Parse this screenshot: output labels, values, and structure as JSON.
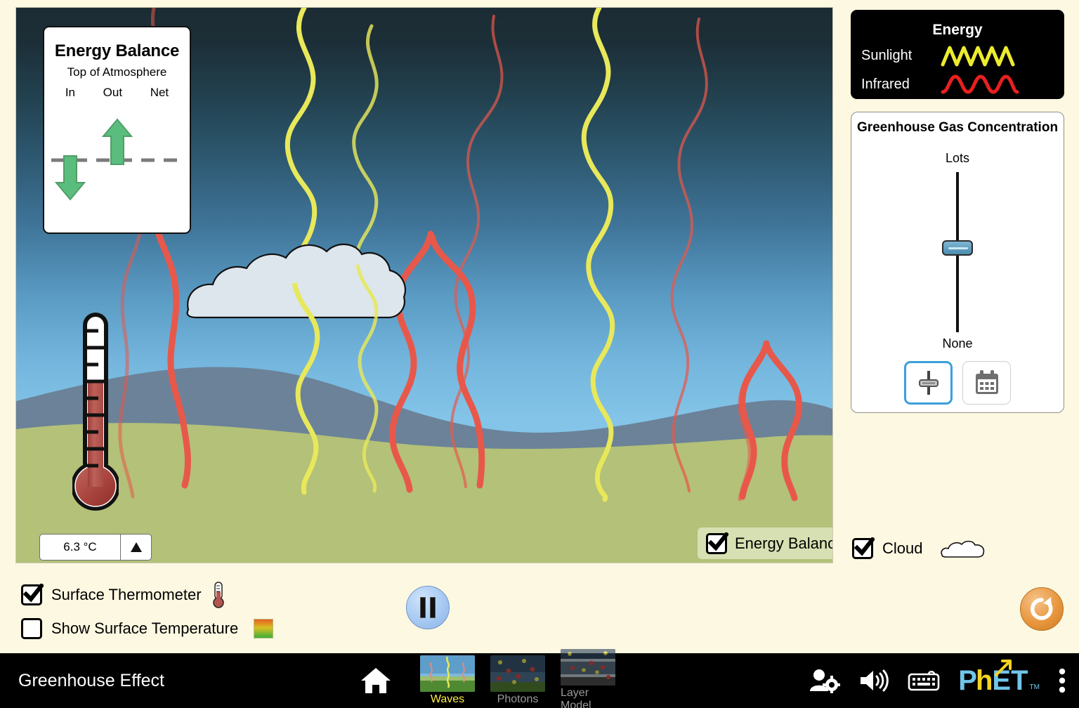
{
  "app": {
    "title": "Greenhouse Effect"
  },
  "energy_balance_panel": {
    "title": "Energy Balance",
    "subtitle": "Top of Atmosphere",
    "columns": [
      "In",
      "Out",
      "Net"
    ],
    "arrow_color": "#5bbd7d",
    "in_direction": "down",
    "out_direction": "up",
    "net_value": "zero"
  },
  "thermometer": {
    "value_label": "6.3 °C",
    "expand_icon": "triangle-up-icon",
    "fill_color": "#b4564f"
  },
  "scene": {
    "energy_balance_checkbox": {
      "label": "Energy Balance",
      "checked": true
    },
    "sky_top_color": "#1b2c34",
    "sky_bottom_color": "#85c5e9",
    "mountain_color": "#6b8299",
    "grass_color": "#b3c179",
    "cloud_fill": "#dce6ec",
    "sunlight_color": "#e8e85a",
    "infrared_color": "#e8584a",
    "waves": {
      "sunlight_x": [
        430,
        520,
        845
      ],
      "infrared_x": [
        190,
        600,
        690,
        980,
        1090
      ]
    }
  },
  "energy_legend": {
    "title": "Energy",
    "rows": [
      {
        "label": "Sunlight",
        "color": "#ecec2f",
        "wave": "high-frequency"
      },
      {
        "label": "Infrared",
        "color": "#e82020",
        "wave": "low-frequency"
      }
    ]
  },
  "ghg_panel": {
    "title": "Greenhouse Gas Concentration",
    "max_label": "Lots",
    "min_label": "None",
    "slider_value_fraction": 0.575,
    "thumb_color": "#5a9ec2",
    "mode_buttons": [
      {
        "name": "slider-mode",
        "icon": "slider-icon",
        "selected": true
      },
      {
        "name": "date-mode",
        "icon": "calendar-icon",
        "selected": false
      }
    ],
    "selected_outline_color": "#3aa0db"
  },
  "cloud_checkbox": {
    "label": "Cloud",
    "checked": true,
    "icon": "cloud-icon"
  },
  "bottom_controls": {
    "checkboxes": [
      {
        "label": "Surface Thermometer",
        "checked": true,
        "icon": "thermometer-icon"
      },
      {
        "label": "Show Surface Temperature",
        "checked": false,
        "icon": "temperature-gradient-swatch"
      }
    ],
    "play_pause": {
      "state": "paused",
      "icon": "pause-icon"
    },
    "reset": {
      "icon": "reset-all-icon",
      "color": "#e8973f"
    }
  },
  "navbar": {
    "title": "Greenhouse Effect",
    "home_icon": "home-icon",
    "screens": [
      {
        "label": "Waves",
        "active": true
      },
      {
        "label": "Photons",
        "active": false
      },
      {
        "label": "Layer Model",
        "active": false
      }
    ],
    "right_icons": [
      "preferences-user-icon",
      "sound-icon",
      "keyboard-shortcuts-icon"
    ],
    "brand": {
      "text_a": "P",
      "text_h": "h",
      "text_et": "ET",
      "tm": "TM",
      "blue": "#6fc5ea",
      "yellow": "#f5d321"
    },
    "menu_icon": "kebab-menu-icon"
  }
}
